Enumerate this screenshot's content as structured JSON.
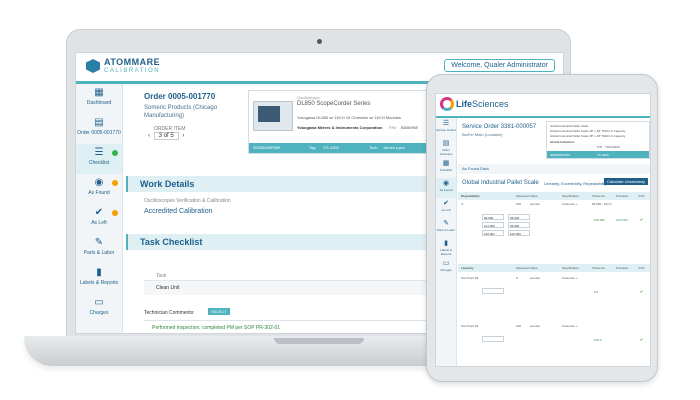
{
  "laptop": {
    "brand": {
      "name": "ATOMMARE",
      "sub": "CALIBRATION"
    },
    "welcome": "Welcome, Qualer Administrator",
    "sidebar": [
      {
        "label": "Dashboard",
        "icon": "grid-icon"
      },
      {
        "label": "Order 0005-001770",
        "icon": "document-icon"
      },
      {
        "label": "Checklist",
        "icon": "list-icon",
        "active": true,
        "badge": "check"
      },
      {
        "label": "As Found",
        "icon": "eye-icon",
        "badge": "warn"
      },
      {
        "label": "As Left",
        "icon": "check-circle-icon",
        "badge": "warn"
      },
      {
        "label": "Parts & Labor",
        "icon": "wrench-icon"
      },
      {
        "label": "Labels & Reports",
        "icon": "file-icon"
      },
      {
        "label": "Charges",
        "icon": "money-icon"
      }
    ],
    "order": {
      "title": "Order 0005-001770",
      "client": "Someric Products (Chicago Manufacturing)",
      "item_label": "ORDER ITEM",
      "item_position": "3 of 5"
    },
    "product": {
      "category": "Oscilloscope",
      "name": "DL850 ScopeCorder Series",
      "description": "Yokogawa DL850 w/ 16CH 16 Channels w/ 16CH Modules",
      "manufacturer": "Yokogawa Meters & Instruments Corporation",
      "pn_label": "P/N",
      "pn": "B8069NE",
      "more_btn": "MORE",
      "strip": {
        "serial": "00005458P809",
        "tag_label": "Tag",
        "tag": "YG-1001",
        "tech_label": "Tech",
        "tech": "James Lynd",
        "more": "MORE"
      }
    },
    "work_details": {
      "title": "Work Details",
      "description": "Oscilloscopes Verification & Calibration",
      "type": "Accredited Calibration"
    },
    "checklist": {
      "title": "Task Checklist",
      "col_task": "Task",
      "col_as": "As",
      "task": "Clean Unit",
      "comments_label": "Technician Comments:",
      "comments_btn": "SELECT",
      "comment": "Performed inspection, completed PM per SOP PR-302-01"
    }
  },
  "tablet": {
    "brand": {
      "part1": "Life",
      "part2": "Sciences"
    },
    "sidebar": [
      {
        "label": "Service Orders",
        "icon": "list-icon"
      },
      {
        "label": "Order Overview",
        "icon": "document-icon"
      },
      {
        "label": "Checklist",
        "icon": "grid-icon"
      },
      {
        "label": "As Found",
        "icon": "eye-icon",
        "active": true
      },
      {
        "label": "As Left",
        "icon": "check-circle-icon"
      },
      {
        "label": "Parts & Labor",
        "icon": "wrench-icon"
      },
      {
        "label": "Labels & Reports",
        "icon": "file-icon"
      },
      {
        "label": "Charges",
        "icon": "money-icon"
      }
    ],
    "order": {
      "title": "Service Order 3381-000057",
      "client": "BioFer Main (Location)"
    },
    "product": {
      "line1": "Global Industrial Pallet Scale",
      "line2": "Global Industrial Pallet Scale 48\" x 48\" 5000 Lb Capacity",
      "line3": "Global Industrial Pallet Scale 48\" x 48\" 5000 Lb Capacity",
      "mfr": "Global Industries",
      "pn_label": "P/N",
      "pn": "TMX34209",
      "strip_serial": "000000054345",
      "strip_tag": "TK-4639"
    },
    "as_found_label": "As Found Data",
    "scale_title": "Global Industrial Pallet Scale",
    "scale_sub": "Linearity, Eccentricity, Repeatability",
    "calc_btn": "Calculate Uncertainty",
    "repeatability": {
      "headers": [
        "Repeatability",
        "Measured Value",
        "Specification",
        "Tolerance",
        "Precision",
        "CV%"
      ],
      "values": [
        "100",
        "pounds",
        "Customer +",
        "99.000 - 101.0"
      ],
      "inputs": [
        "99.000",
        "99.003",
        "101.000",
        "99.000",
        "100.001",
        "100.000"
      ],
      "result": [
        "100.000",
        "0.0774%"
      ]
    },
    "linearity": {
      "headers": [
        "Linearity",
        "Measured Value",
        "Specification",
        "Tolerance",
        "Precision",
        "CV%"
      ],
      "rows": [
        {
          "point": "Test Point #6",
          "value": "0",
          "unit": "pounds",
          "spec": "Customer +",
          "result": "0.0"
        },
        {
          "point": "Test Point #1",
          "value": "100",
          "unit": "pounds",
          "spec": "Customer +",
          "result": "100.0"
        }
      ]
    }
  }
}
